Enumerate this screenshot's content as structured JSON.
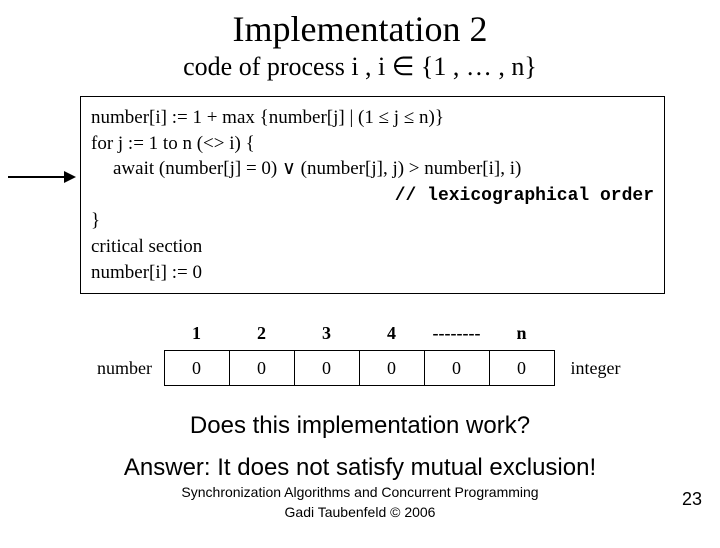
{
  "title": "Implementation 2",
  "subtitle": "code of process i ,   i ∈ {1 , … , n}",
  "code": {
    "l1": "number[i] := 1 + max {number[j] | (1 ≤ j ≤ n)}",
    "l2": "for j := 1 to n (<> i) {",
    "l3": "await (number[j] = 0) ∨ (number[j], j) > number[i], i)",
    "comment": "// lexicographical order",
    "l4": "}",
    "l5": "critical section",
    "l6": "number[i] := 0"
  },
  "array": {
    "label": "number",
    "headers": [
      "1",
      "2",
      "3",
      "4",
      "--------",
      "n"
    ],
    "cells": [
      "0",
      "0",
      "0",
      "0",
      "0",
      "0"
    ],
    "type": "integer"
  },
  "question": "Does this implementation work?",
  "answer": "Answer:  It does not satisfy mutual exclusion!",
  "footer1": "Synchronization Algorithms and Concurrent Programming",
  "footer2": "Gadi Taubenfeld © 2006",
  "pagenum": "23"
}
